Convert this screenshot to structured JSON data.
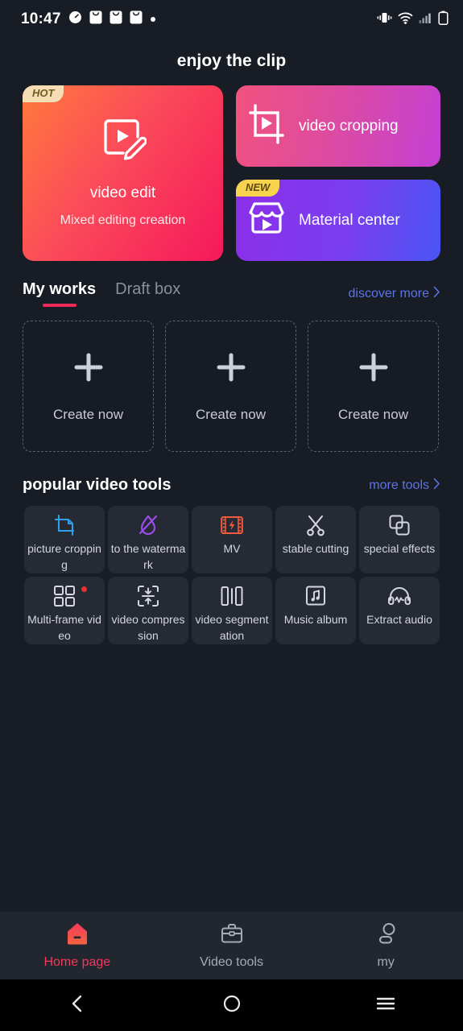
{
  "status_bar": {
    "time": "10:47",
    "left_icons": [
      "clock-icon",
      "mail-icon",
      "mail-icon",
      "mail-icon",
      "dot-icon"
    ],
    "right_icons": [
      "vibrate-icon",
      "wifi-icon",
      "signal-icon",
      "battery-icon"
    ]
  },
  "header": {
    "title": "enjoy the clip"
  },
  "hero": {
    "main": {
      "badge": "HOT",
      "title": "video edit",
      "subtitle": "Mixed editing creation",
      "icon": "video-edit-icon",
      "gradient_from": "#ff7a3c",
      "gradient_to": "#f5185b"
    },
    "cropping": {
      "label": "video cropping",
      "icon": "crop-play-icon",
      "gradient_from": "#f2527e",
      "gradient_to": "#c43fd4"
    },
    "material": {
      "badge": "NEW",
      "label": "Material center",
      "icon": "store-play-icon",
      "gradient_from": "#8b2fe8",
      "gradient_to": "#4a55f2"
    }
  },
  "works_section": {
    "tabs": [
      {
        "label": "My works",
        "active": true
      },
      {
        "label": "Draft box",
        "active": false
      }
    ],
    "link": {
      "label": "discover more",
      "icon": "chevron-right-icon",
      "color": "#5b74e8"
    },
    "cards": [
      {
        "label": "Create now",
        "icon": "plus-icon"
      },
      {
        "label": "Create now",
        "icon": "plus-icon"
      },
      {
        "label": "Create now",
        "icon": "plus-icon"
      }
    ],
    "accent_color": "#ef2a5b"
  },
  "tools_section": {
    "title": "popular video tools",
    "link": {
      "label": "more tools",
      "icon": "chevron-right-icon",
      "color": "#5b74e8"
    },
    "tools": [
      {
        "label": "picture cropping",
        "icon": "picture-crop-icon",
        "color": "#2f9fe6",
        "badge": false
      },
      {
        "label": "to the watermark",
        "icon": "watermark-off-icon",
        "color": "#9b4df0",
        "badge": false
      },
      {
        "label": "MV",
        "icon": "film-bolt-icon",
        "color": "#f05a3c",
        "badge": false
      },
      {
        "label": "stable cutting",
        "icon": "scissors-icon",
        "color": "#d4d7dd",
        "badge": false
      },
      {
        "label": "special effects",
        "icon": "layers-icon",
        "color": "#d4d7dd",
        "badge": false
      },
      {
        "label": "Multi-frame video",
        "icon": "grid-icon",
        "color": "#d4d7dd",
        "badge": true
      },
      {
        "label": "video compression",
        "icon": "compress-icon",
        "color": "#d4d7dd",
        "badge": false
      },
      {
        "label": "video segmentation",
        "icon": "split-icon",
        "color": "#d4d7dd",
        "badge": false
      },
      {
        "label": "Music album",
        "icon": "music-note-icon",
        "color": "#d4d7dd",
        "badge": false
      },
      {
        "label": "Extract audio",
        "icon": "headphones-icon",
        "color": "#d4d7dd",
        "badge": false
      }
    ]
  },
  "bottom_nav": {
    "items": [
      {
        "label": "Home page",
        "icon": "home-icon",
        "active": true
      },
      {
        "label": "Video tools",
        "icon": "briefcase-icon",
        "active": false
      },
      {
        "label": "my",
        "icon": "person-icon",
        "active": false
      }
    ],
    "active_color": "#f4385c"
  },
  "system_nav": {
    "buttons": [
      {
        "name": "back-button",
        "icon": "chevron-left-icon"
      },
      {
        "name": "home-button",
        "icon": "circle-icon"
      },
      {
        "name": "recents-button",
        "icon": "menu-icon"
      }
    ]
  }
}
